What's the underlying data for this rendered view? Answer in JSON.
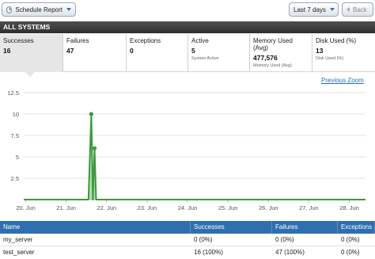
{
  "toolbar": {
    "schedule_label": "Schedule Report",
    "range_label": "Last 7 days",
    "back_label": "Back"
  },
  "section": {
    "title": "ALL SYSTEMS"
  },
  "metrics": [
    {
      "label": "Successes",
      "value": "16",
      "sub": ""
    },
    {
      "label": "Failures",
      "value": "47",
      "sub": ""
    },
    {
      "label": "Exceptions",
      "value": "0",
      "sub": ""
    },
    {
      "label": "Active",
      "value": "5",
      "sub": "System Active"
    },
    {
      "label": "Memory Used (Avg)",
      "value": "477,576",
      "sub": "Memory Used (Avg)"
    },
    {
      "label": "Disk Used (%)",
      "value": "13",
      "sub": "Disk Used (%)"
    }
  ],
  "chart_links": {
    "previous_zoom": "Previous Zoom"
  },
  "chart_data": {
    "type": "line",
    "x_tick_labels": [
      "20. Jun",
      "21. Jun",
      "22. Jun",
      "23. Jun",
      "24. Jun",
      "25. Jun",
      "26. Jun",
      "27. Jun",
      "28. Jun"
    ],
    "y_tick_labels": [
      "2.5",
      "5",
      "7.5",
      "10",
      "12.5"
    ],
    "ylim": [
      0,
      12.5
    ],
    "xlim": [
      19.95,
      28.4
    ],
    "grid": true,
    "series": [
      {
        "color": "#3a9a3a",
        "x": [
          19.95,
          21.55,
          21.62,
          21.66,
          21.7,
          21.74,
          21.8,
          28.4
        ],
        "y": [
          0,
          0,
          10,
          0,
          6,
          0,
          0,
          0
        ]
      }
    ]
  },
  "table": {
    "headers": [
      "Name",
      "Successes",
      "Failures",
      "Exceptions"
    ],
    "rows": [
      [
        "my_server",
        "0 (0%)",
        "0 (0%)",
        "0 (0%)"
      ],
      [
        "test_server",
        "16 (100%)",
        "47 (100%)",
        "0 (0%)"
      ]
    ]
  }
}
